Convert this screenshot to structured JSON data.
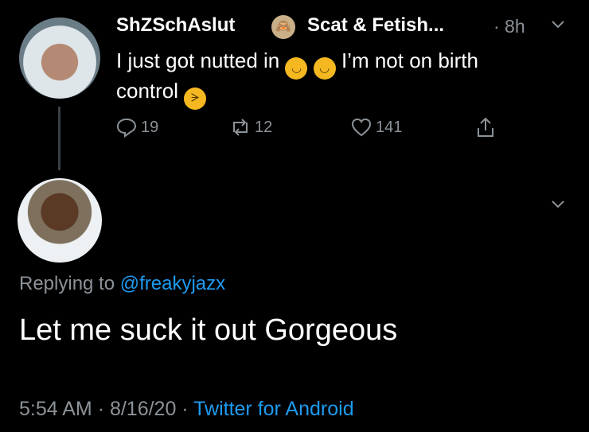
{
  "tweet": {
    "author_name": "ShZSchAslut",
    "author_badge_icon": "see-no-evil-monkey",
    "handle": "Scat & Fetish...",
    "time": "· 8h",
    "text_line1_start": "I just got nutted in",
    "text_line1_end": "I’m not on birth",
    "text_line2": "control",
    "emoji_upside_down": "upside-down-face",
    "emoji_laughing": "rolling-on-floor-laughing",
    "reply_count": "19",
    "retweet_count": "12",
    "like_count": "141"
  },
  "reply": {
    "replying_prefix": "Replying to",
    "replying_mention": "@freakyjazx",
    "text": "Let me suck it out Gorgeous",
    "timestamp": "5:54 AM · 8/16/20 ·",
    "source": "Twitter for Android"
  },
  "colors": {
    "background": "#000000",
    "text": "#ffffff",
    "muted": "#8b9298",
    "accent": "#1d9bf0"
  }
}
